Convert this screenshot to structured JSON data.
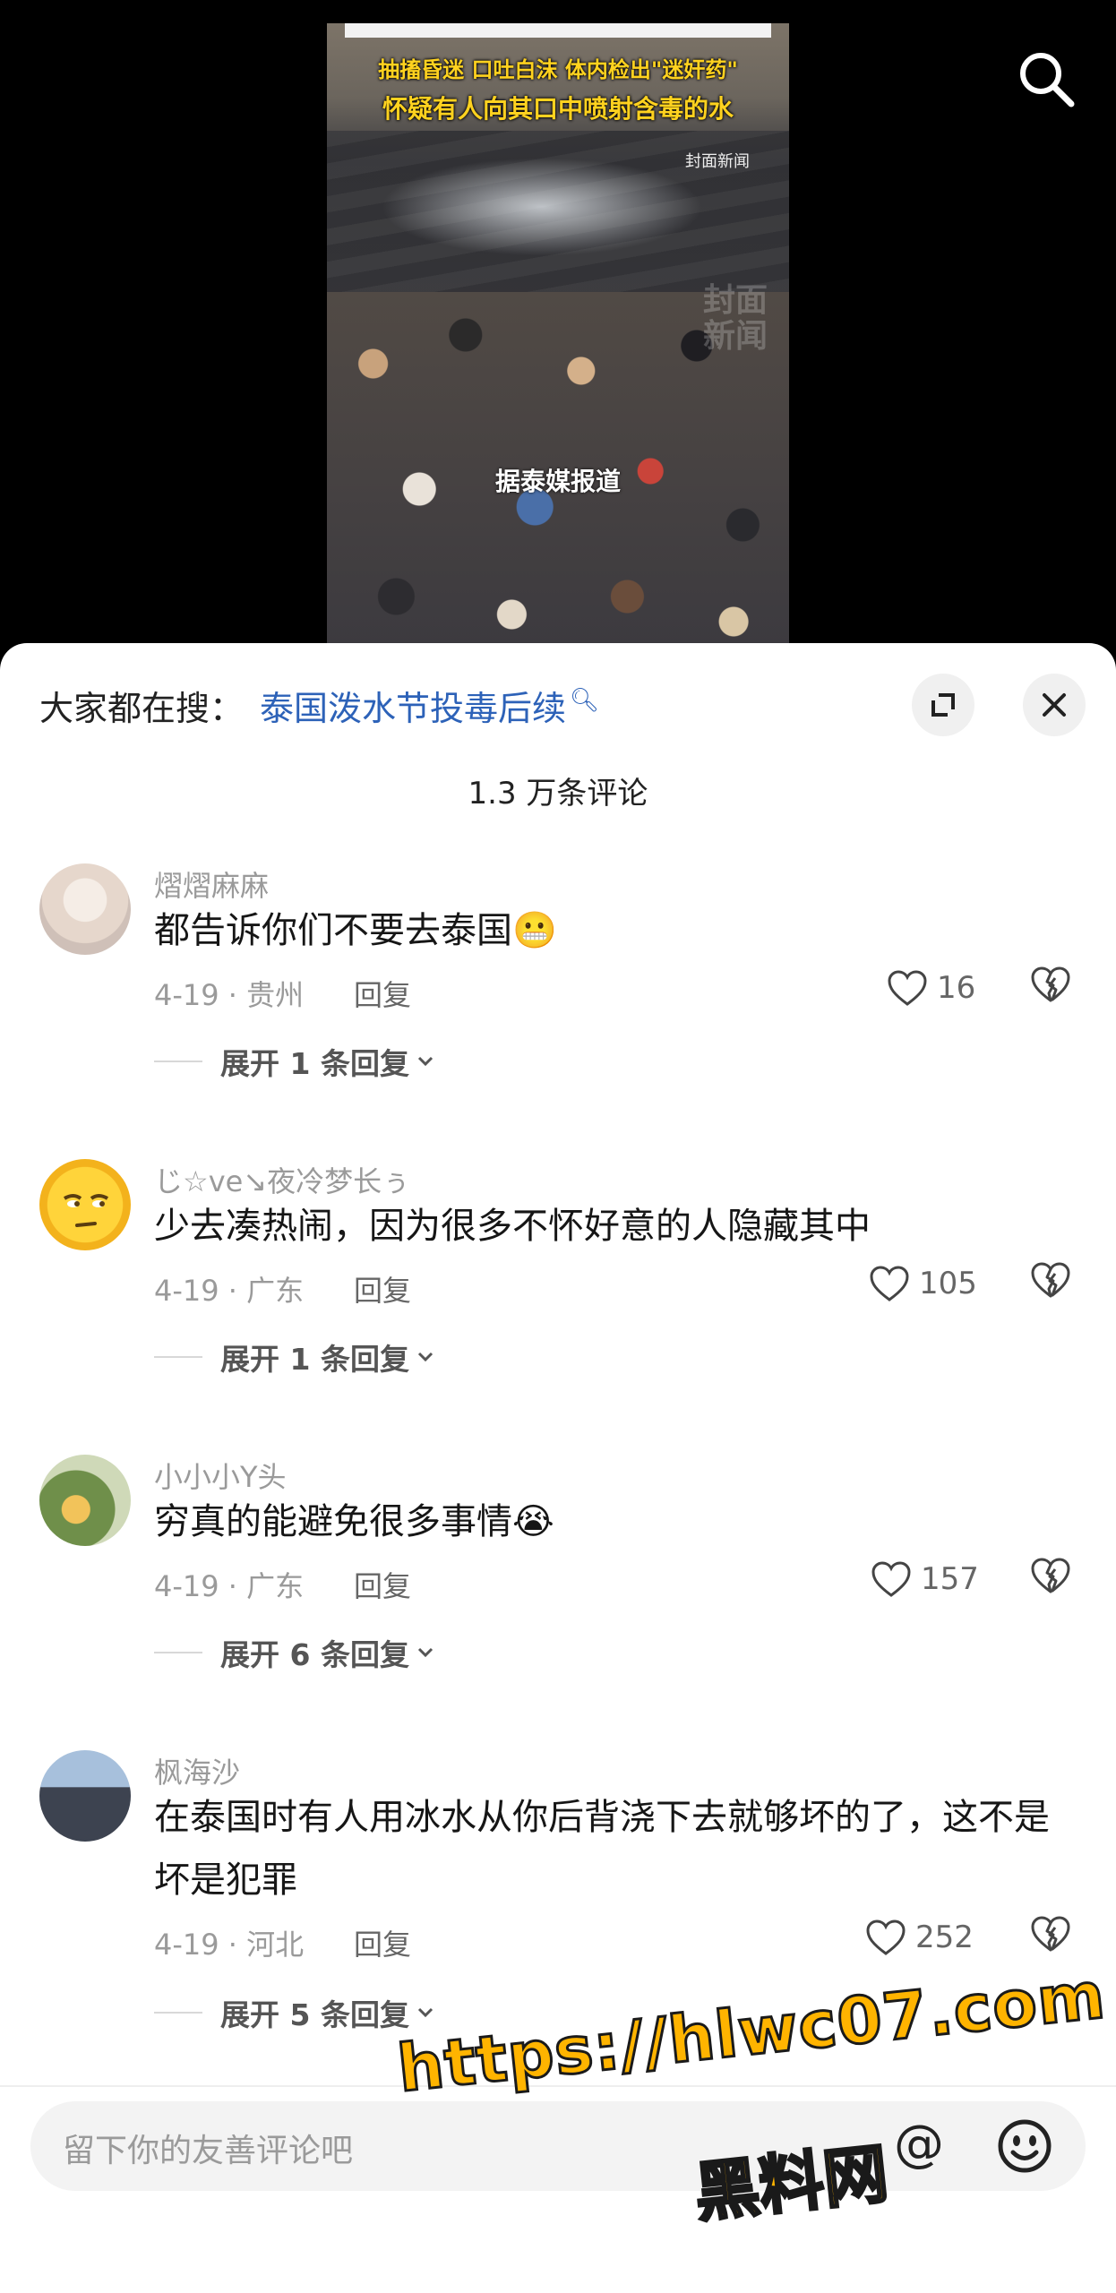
{
  "video": {
    "headline_line1": "抽搐昏迷 口吐白沫 体内检出\"迷奸药\"",
    "headline_line2": "怀疑有人向其口中喷射含毒的水",
    "source_tag": "封面新闻",
    "caption": "据泰媒报道",
    "watermark": "封面新闻"
  },
  "search_icon": "search-icon",
  "sheet": {
    "trending_prefix": "大家都在搜：",
    "trending_query": "泰国泼水节投毒后续",
    "comment_count": "1.3 万条评论"
  },
  "comments": [
    {
      "username": "熠熠麻麻",
      "text": "都告诉你们不要去泰国😬",
      "meta": "4-19 · 贵州",
      "reply_label": "回复",
      "likes": "16",
      "expand": "展开 1 条回复"
    },
    {
      "username": "じ☆ve↘夜冷梦长ぅ",
      "text": "少去凑热闹，因为很多不怀好意的人隐藏其中",
      "meta": "4-19 · 广东",
      "reply_label": "回复",
      "likes": "105",
      "expand": "展开 1 条回复"
    },
    {
      "username": "小小小Y头",
      "text": "穷真的能避免很多事情😭",
      "meta": "4-19 · 广东",
      "reply_label": "回复",
      "likes": "157",
      "expand": "展开 6 条回复"
    },
    {
      "username": "枫海沙",
      "text": "在泰国时有人用冰水从你后背浇下去就够坏的了，这不是坏是犯罪",
      "meta": "4-19 · 河北",
      "reply_label": "回复",
      "likes": "252",
      "expand": "展开 5 条回复"
    }
  ],
  "input": {
    "placeholder": "留下你的友善评论吧",
    "at_symbol": "@"
  },
  "overlay": {
    "url": "https://hlwc07.com",
    "site_name": "黑料网"
  }
}
